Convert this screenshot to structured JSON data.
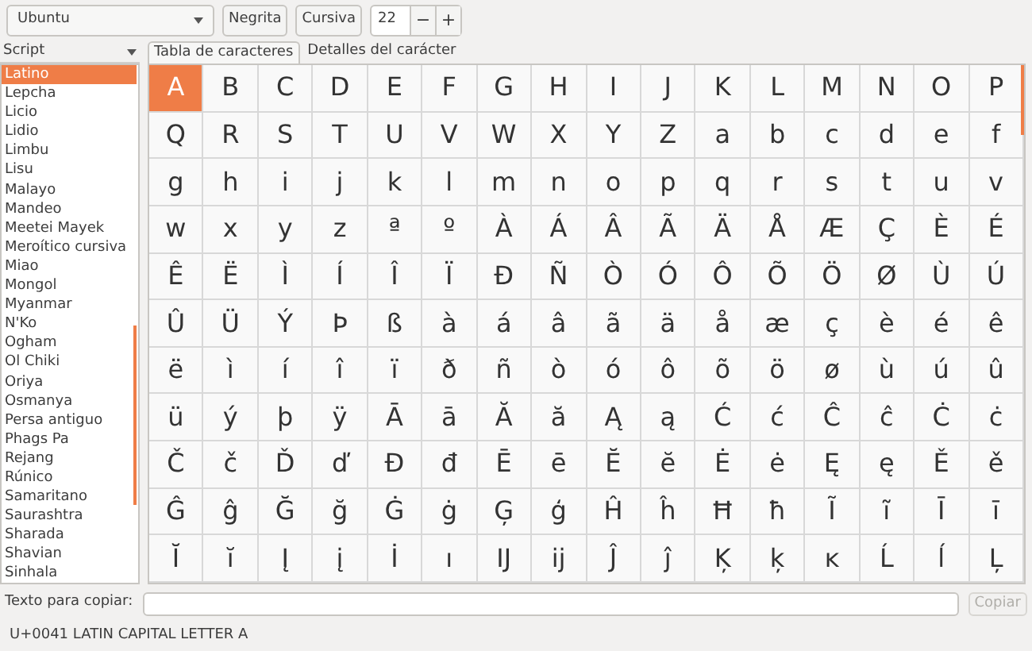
{
  "toolbar": {
    "font": "Ubuntu",
    "bold_button": "Negrita",
    "italic_button": "Cursiva",
    "size": "22",
    "decrease": "−",
    "increase": "+"
  },
  "sidebar": {
    "header": "Script",
    "items": [
      {
        "label": "Latino",
        "selected": true
      },
      {
        "label": "Lepcha",
        "selected": false
      },
      {
        "label": "Licio",
        "selected": false
      },
      {
        "label": "Lidio",
        "selected": false
      },
      {
        "label": "Limbu",
        "selected": false
      },
      {
        "label": "Lisu",
        "selected": false
      },
      {
        "label": "Malayo",
        "selected": false
      },
      {
        "label": "Mandeo",
        "selected": false
      },
      {
        "label": "Meetei Mayek",
        "selected": false
      },
      {
        "label": "Meroítico cursiva",
        "selected": false
      },
      {
        "label": "Miao",
        "selected": false
      },
      {
        "label": "Mongol",
        "selected": false
      },
      {
        "label": "Myanmar",
        "selected": false
      },
      {
        "label": "N'Ko",
        "selected": false
      },
      {
        "label": "Ogham",
        "selected": false
      },
      {
        "label": "Ol Chiki",
        "selected": false
      },
      {
        "label": "Oriya",
        "selected": false
      },
      {
        "label": "Osmanya",
        "selected": false
      },
      {
        "label": "Persa antiguo",
        "selected": false
      },
      {
        "label": "Phags Pa",
        "selected": false
      },
      {
        "label": "Rejang",
        "selected": false
      },
      {
        "label": "Rúnico",
        "selected": false
      },
      {
        "label": "Samaritano",
        "selected": false
      },
      {
        "label": "Saurashtra",
        "selected": false
      },
      {
        "label": "Sharada",
        "selected": false
      },
      {
        "label": "Shavian",
        "selected": false
      },
      {
        "label": "Sinhala",
        "selected": false
      }
    ]
  },
  "tabs": [
    {
      "label": "Tabla de caracteres",
      "selected": true
    },
    {
      "label": "Detalles del carácter",
      "selected": false
    }
  ],
  "grid": {
    "rows": [
      [
        {
          "c": "A",
          "selected": true
        },
        {
          "c": "B",
          "selected": false
        },
        {
          "c": "C",
          "selected": false
        },
        {
          "c": "D",
          "selected": false
        },
        {
          "c": "E",
          "selected": false
        },
        {
          "c": "F",
          "selected": false
        },
        {
          "c": "G",
          "selected": false
        },
        {
          "c": "H",
          "selected": false
        },
        {
          "c": "I",
          "selected": false
        },
        {
          "c": "J",
          "selected": false
        },
        {
          "c": "K",
          "selected": false
        },
        {
          "c": "L",
          "selected": false
        },
        {
          "c": "M",
          "selected": false
        },
        {
          "c": "N",
          "selected": false
        },
        {
          "c": "O",
          "selected": false
        },
        {
          "c": "P",
          "selected": false
        }
      ],
      [
        {
          "c": "Q",
          "selected": false
        },
        {
          "c": "R",
          "selected": false
        },
        {
          "c": "S",
          "selected": false
        },
        {
          "c": "T",
          "selected": false
        },
        {
          "c": "U",
          "selected": false
        },
        {
          "c": "V",
          "selected": false
        },
        {
          "c": "W",
          "selected": false
        },
        {
          "c": "X",
          "selected": false
        },
        {
          "c": "Y",
          "selected": false
        },
        {
          "c": "Z",
          "selected": false
        },
        {
          "c": "a",
          "selected": false
        },
        {
          "c": "b",
          "selected": false
        },
        {
          "c": "c",
          "selected": false
        },
        {
          "c": "d",
          "selected": false
        },
        {
          "c": "e",
          "selected": false
        },
        {
          "c": "f",
          "selected": false
        }
      ],
      [
        {
          "c": "g",
          "selected": false
        },
        {
          "c": "h",
          "selected": false
        },
        {
          "c": "i",
          "selected": false
        },
        {
          "c": "j",
          "selected": false
        },
        {
          "c": "k",
          "selected": false
        },
        {
          "c": "l",
          "selected": false
        },
        {
          "c": "m",
          "selected": false
        },
        {
          "c": "n",
          "selected": false
        },
        {
          "c": "o",
          "selected": false
        },
        {
          "c": "p",
          "selected": false
        },
        {
          "c": "q",
          "selected": false
        },
        {
          "c": "r",
          "selected": false
        },
        {
          "c": "s",
          "selected": false
        },
        {
          "c": "t",
          "selected": false
        },
        {
          "c": "u",
          "selected": false
        },
        {
          "c": "v",
          "selected": false
        }
      ],
      [
        {
          "c": "w",
          "selected": false
        },
        {
          "c": "x",
          "selected": false
        },
        {
          "c": "y",
          "selected": false
        },
        {
          "c": "z",
          "selected": false
        },
        {
          "c": "ª",
          "selected": false
        },
        {
          "c": "º",
          "selected": false
        },
        {
          "c": "À",
          "selected": false
        },
        {
          "c": "Á",
          "selected": false
        },
        {
          "c": "Â",
          "selected": false
        },
        {
          "c": "Ã",
          "selected": false
        },
        {
          "c": "Ä",
          "selected": false
        },
        {
          "c": "Å",
          "selected": false
        },
        {
          "c": "Æ",
          "selected": false
        },
        {
          "c": "Ç",
          "selected": false
        },
        {
          "c": "È",
          "selected": false
        },
        {
          "c": "É",
          "selected": false
        }
      ],
      [
        {
          "c": "Ê",
          "selected": false
        },
        {
          "c": "Ë",
          "selected": false
        },
        {
          "c": "Ì",
          "selected": false
        },
        {
          "c": "Í",
          "selected": false
        },
        {
          "c": "Î",
          "selected": false
        },
        {
          "c": "Ï",
          "selected": false
        },
        {
          "c": "Ð",
          "selected": false
        },
        {
          "c": "Ñ",
          "selected": false
        },
        {
          "c": "Ò",
          "selected": false
        },
        {
          "c": "Ó",
          "selected": false
        },
        {
          "c": "Ô",
          "selected": false
        },
        {
          "c": "Õ",
          "selected": false
        },
        {
          "c": "Ö",
          "selected": false
        },
        {
          "c": "Ø",
          "selected": false
        },
        {
          "c": "Ù",
          "selected": false
        },
        {
          "c": "Ú",
          "selected": false
        }
      ],
      [
        {
          "c": "Û",
          "selected": false
        },
        {
          "c": "Ü",
          "selected": false
        },
        {
          "c": "Ý",
          "selected": false
        },
        {
          "c": "Þ",
          "selected": false
        },
        {
          "c": "ß",
          "selected": false
        },
        {
          "c": "à",
          "selected": false
        },
        {
          "c": "á",
          "selected": false
        },
        {
          "c": "â",
          "selected": false
        },
        {
          "c": "ã",
          "selected": false
        },
        {
          "c": "ä",
          "selected": false
        },
        {
          "c": "å",
          "selected": false
        },
        {
          "c": "æ",
          "selected": false
        },
        {
          "c": "ç",
          "selected": false
        },
        {
          "c": "è",
          "selected": false
        },
        {
          "c": "é",
          "selected": false
        },
        {
          "c": "ê",
          "selected": false
        }
      ],
      [
        {
          "c": "ë",
          "selected": false
        },
        {
          "c": "ì",
          "selected": false
        },
        {
          "c": "í",
          "selected": false
        },
        {
          "c": "î",
          "selected": false
        },
        {
          "c": "ï",
          "selected": false
        },
        {
          "c": "ð",
          "selected": false
        },
        {
          "c": "ñ",
          "selected": false
        },
        {
          "c": "ò",
          "selected": false
        },
        {
          "c": "ó",
          "selected": false
        },
        {
          "c": "ô",
          "selected": false
        },
        {
          "c": "õ",
          "selected": false
        },
        {
          "c": "ö",
          "selected": false
        },
        {
          "c": "ø",
          "selected": false
        },
        {
          "c": "ù",
          "selected": false
        },
        {
          "c": "ú",
          "selected": false
        },
        {
          "c": "û",
          "selected": false
        }
      ],
      [
        {
          "c": "ü",
          "selected": false
        },
        {
          "c": "ý",
          "selected": false
        },
        {
          "c": "þ",
          "selected": false
        },
        {
          "c": "ÿ",
          "selected": false
        },
        {
          "c": "Ā",
          "selected": false
        },
        {
          "c": "ā",
          "selected": false
        },
        {
          "c": "Ă",
          "selected": false
        },
        {
          "c": "ă",
          "selected": false
        },
        {
          "c": "Ą",
          "selected": false
        },
        {
          "c": "ą",
          "selected": false
        },
        {
          "c": "Ć",
          "selected": false
        },
        {
          "c": "ć",
          "selected": false
        },
        {
          "c": "Ĉ",
          "selected": false
        },
        {
          "c": "ĉ",
          "selected": false
        },
        {
          "c": "Ċ",
          "selected": false
        },
        {
          "c": "ċ",
          "selected": false
        }
      ],
      [
        {
          "c": "Č",
          "selected": false
        },
        {
          "c": "č",
          "selected": false
        },
        {
          "c": "Ď",
          "selected": false
        },
        {
          "c": "ď",
          "selected": false
        },
        {
          "c": "Đ",
          "selected": false
        },
        {
          "c": "đ",
          "selected": false
        },
        {
          "c": "Ē",
          "selected": false
        },
        {
          "c": "ē",
          "selected": false
        },
        {
          "c": "Ĕ",
          "selected": false
        },
        {
          "c": "ĕ",
          "selected": false
        },
        {
          "c": "Ė",
          "selected": false
        },
        {
          "c": "ė",
          "selected": false
        },
        {
          "c": "Ę",
          "selected": false
        },
        {
          "c": "ę",
          "selected": false
        },
        {
          "c": "Ě",
          "selected": false
        },
        {
          "c": "ě",
          "selected": false
        }
      ],
      [
        {
          "c": "Ĝ",
          "selected": false
        },
        {
          "c": "ĝ",
          "selected": false
        },
        {
          "c": "Ğ",
          "selected": false
        },
        {
          "c": "ğ",
          "selected": false
        },
        {
          "c": "Ġ",
          "selected": false
        },
        {
          "c": "ġ",
          "selected": false
        },
        {
          "c": "Ģ",
          "selected": false
        },
        {
          "c": "ģ",
          "selected": false
        },
        {
          "c": "Ĥ",
          "selected": false
        },
        {
          "c": "ĥ",
          "selected": false
        },
        {
          "c": "Ħ",
          "selected": false
        },
        {
          "c": "ħ",
          "selected": false
        },
        {
          "c": "Ĩ",
          "selected": false
        },
        {
          "c": "ĩ",
          "selected": false
        },
        {
          "c": "Ī",
          "selected": false
        },
        {
          "c": "ī",
          "selected": false
        }
      ],
      [
        {
          "c": "Ĭ",
          "selected": false
        },
        {
          "c": "ĭ",
          "selected": false
        },
        {
          "c": "Į",
          "selected": false
        },
        {
          "c": "į",
          "selected": false
        },
        {
          "c": "İ",
          "selected": false
        },
        {
          "c": "ı",
          "selected": false
        },
        {
          "c": "Ĳ",
          "selected": false
        },
        {
          "c": "ĳ",
          "selected": false
        },
        {
          "c": "Ĵ",
          "selected": false
        },
        {
          "c": "ĵ",
          "selected": false
        },
        {
          "c": "Ķ",
          "selected": false
        },
        {
          "c": "ķ",
          "selected": false
        },
        {
          "c": "ĸ",
          "selected": false
        },
        {
          "c": "Ĺ",
          "selected": false
        },
        {
          "c": "ĺ",
          "selected": false
        },
        {
          "c": "Ļ",
          "selected": false
        }
      ]
    ]
  },
  "copy": {
    "label": "Texto para copiar:",
    "button": "Copiar",
    "button_disabled": true
  },
  "status_bar": "U+0041 LATIN CAPITAL LETTER A"
}
